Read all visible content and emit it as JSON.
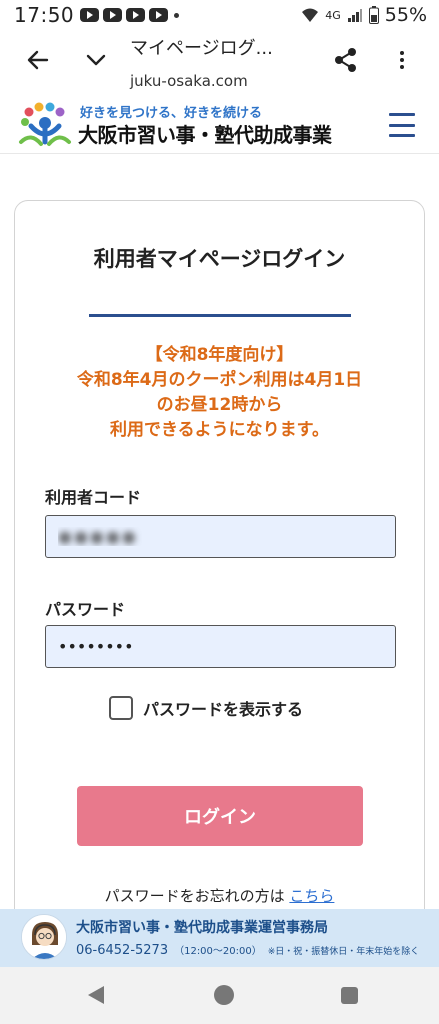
{
  "status_bar": {
    "time": "17:50",
    "network": "4G",
    "battery": "55%"
  },
  "browser": {
    "page_title": "マイページログ...",
    "url": "juku-osaka.com"
  },
  "site_header": {
    "tagline": "好きを見つける、好きを続ける",
    "site_name": "大阪市習い事・塾代助成事業"
  },
  "login": {
    "title": "利用者マイページログイン",
    "notice_lines": [
      "【令和8年度向け】",
      "令和8年4月のクーポン利用は4月1日",
      "のお昼12時から",
      "利用できるようになります。"
    ],
    "user_code_label": "利用者コード",
    "user_code_value": "●●●●●",
    "password_label": "パスワード",
    "password_value": "••••••••",
    "show_password_label": "パスワードを表示する",
    "login_button": "ログイン",
    "forgot_text": "パスワードをお忘れの方は",
    "forgot_link": "こちら"
  },
  "footer": {
    "office_name": "大阪市習い事・塾代助成事業運営事務局",
    "phone": "06-6452-5273",
    "hours": "（12:00～20:00）",
    "closed_days": "※日・祝・振替休日・年末年始を除く"
  }
}
